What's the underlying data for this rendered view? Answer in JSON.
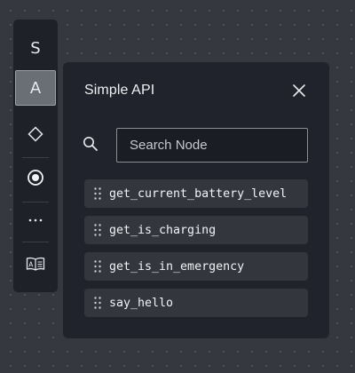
{
  "toolbar": {
    "buttons": [
      {
        "id": "s",
        "label": "S"
      },
      {
        "id": "a",
        "label": "A",
        "active": true
      },
      {
        "id": "diamond",
        "icon": "diamond-icon"
      },
      {
        "id": "target",
        "icon": "radio-target-icon"
      },
      {
        "id": "more",
        "icon": "more-horizontal-icon"
      },
      {
        "id": "book",
        "icon": "book-icon"
      }
    ]
  },
  "panel": {
    "title": "Simple API",
    "close_icon": "close-icon",
    "search": {
      "placeholder": "Search Node",
      "value": "",
      "icon": "search-icon"
    },
    "nodes": [
      {
        "label": "get_current_battery_level"
      },
      {
        "label": "get_is_charging"
      },
      {
        "label": "get_is_in_emergency"
      },
      {
        "label": "say_hello"
      }
    ]
  },
  "colors": {
    "canvas_bg": "#363840",
    "panel_bg": "#20232b",
    "item_bg": "#33363d",
    "active_button_bg": "#6a6e75"
  }
}
